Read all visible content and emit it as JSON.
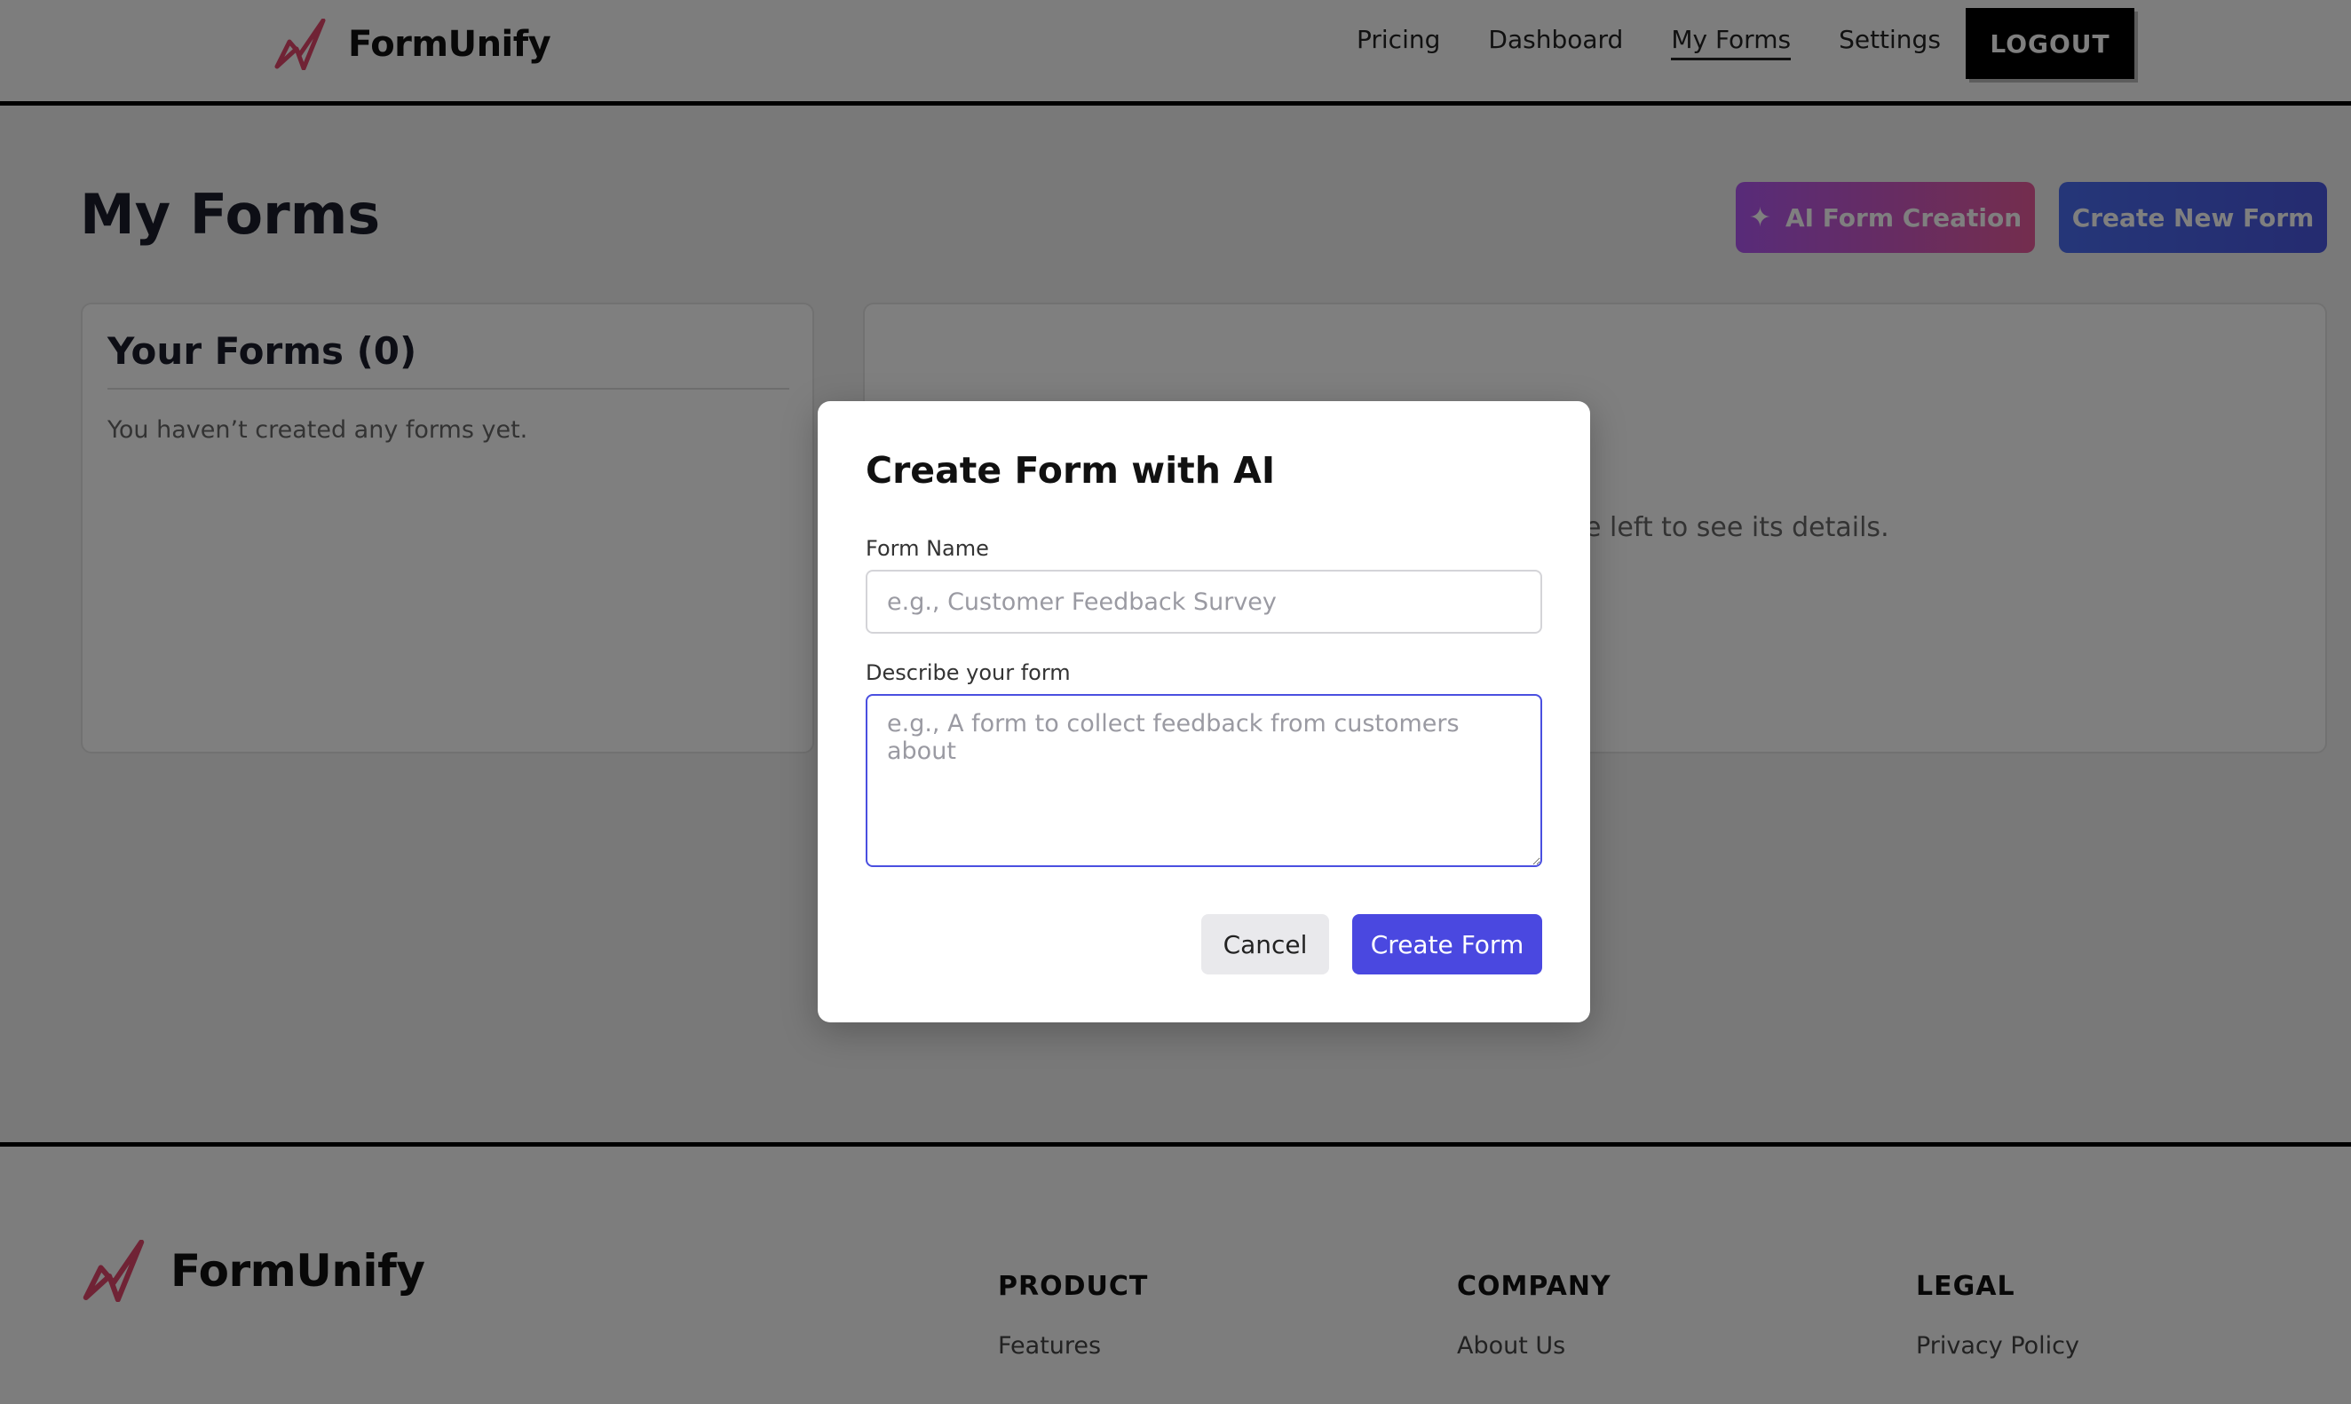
{
  "brand": {
    "name": "FormUnify",
    "accent": "#e0476b"
  },
  "nav": {
    "items": [
      {
        "label": "Pricing"
      },
      {
        "label": "Dashboard"
      },
      {
        "label": "My Forms",
        "active": true
      },
      {
        "label": "Settings"
      }
    ],
    "logout_label": "LOGOUT"
  },
  "main": {
    "title": "My Forms",
    "ai_button_label": "AI Form Creation",
    "new_button_label": "Create New Form",
    "forms_panel": {
      "title": "Your Forms (0)",
      "empty_message": "You haven’t created any forms yet."
    },
    "details_panel": {
      "message": "Select a form from the left to see its details."
    }
  },
  "modal": {
    "title": "Create Form with AI",
    "name_label": "Form Name",
    "name_value": "",
    "name_placeholder": "e.g., Customer Feedback Survey",
    "desc_label": "Describe your form",
    "desc_value": "",
    "desc_placeholder": "e.g., A form to collect feedback from customers about",
    "cancel_label": "Cancel",
    "create_label": "Create Form",
    "primary_color": "#4a48e0"
  },
  "footer": {
    "brand_name": "FormUnify",
    "columns": [
      {
        "heading": "PRODUCT",
        "first_link": "Features"
      },
      {
        "heading": "COMPANY",
        "first_link": "About Us"
      },
      {
        "heading": "LEGAL",
        "first_link": "Privacy Policy"
      }
    ]
  },
  "icons": {
    "logo": "paper-plane-logo-icon",
    "ai_sparkle": "sparkle-icon"
  }
}
